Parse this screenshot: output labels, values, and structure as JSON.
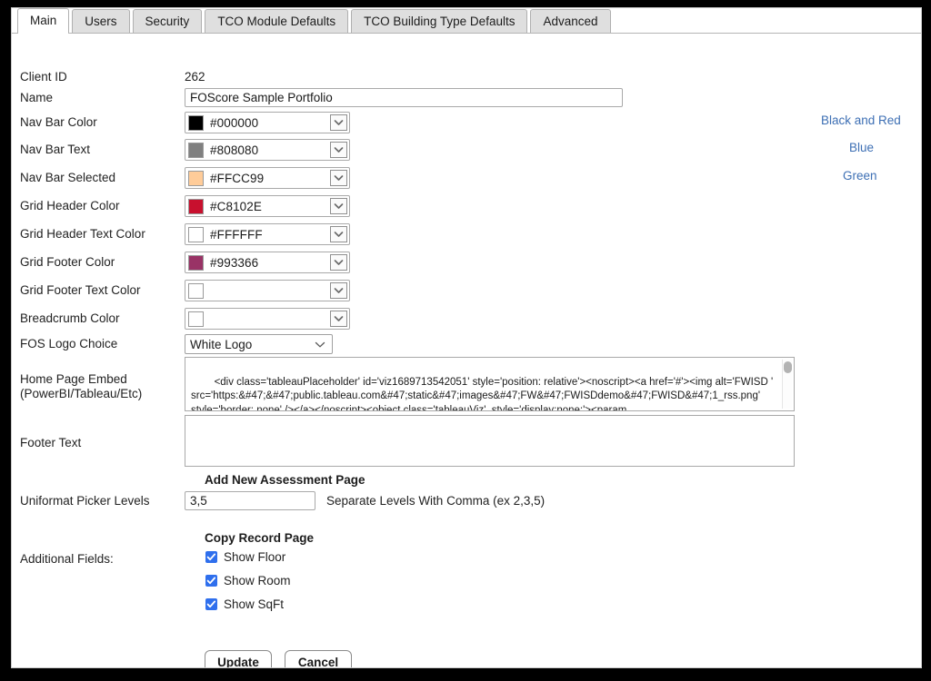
{
  "tabs": [
    {
      "label": "Main",
      "active": true
    },
    {
      "label": "Users",
      "active": false
    },
    {
      "label": "Security",
      "active": false
    },
    {
      "label": "TCO Module Defaults",
      "active": false
    },
    {
      "label": "TCO Building Type Defaults",
      "active": false
    },
    {
      "label": "Advanced",
      "active": false
    }
  ],
  "form": {
    "client_id_label": "Client ID",
    "client_id_value": "262",
    "name_label": "Name",
    "name_value": "FOScore Sample Portfolio",
    "nav_bar_color_label": "Nav Bar Color",
    "nav_bar_color_value": "#000000",
    "nav_bar_text_label": "Nav Bar Text",
    "nav_bar_text_value": "#808080",
    "nav_bar_selected_label": "Nav Bar Selected",
    "nav_bar_selected_value": "#FFCC99",
    "grid_header_color_label": "Grid Header Color",
    "grid_header_color_value": "#C8102E",
    "grid_header_text_color_label": "Grid Header Text Color",
    "grid_header_text_color_value": "#FFFFFF",
    "grid_footer_color_label": "Grid Footer Color",
    "grid_footer_color_value": "#993366",
    "grid_footer_text_color_label": "Grid Footer Text Color",
    "grid_footer_text_color_value": "",
    "breadcrumb_color_label": "Breadcrumb Color",
    "breadcrumb_color_value": "",
    "fos_logo_choice_label": "FOS Logo Choice",
    "fos_logo_choice_value": "White Logo",
    "home_page_embed_label": "Home Page Embed (PowerBI/Tableau/Etc)",
    "home_page_embed_value": "<div class='tableauPlaceholder' id='viz1689713542051' style='position: relative'><noscript><a href='#'><img alt='FWISD ' src='https:&#47;&#47;public.tableau.com&#47;static&#47;images&#47;FW&#47;FWISDdemo&#47;FWISD&#47;1_rss.png' style='border: none' /></a></noscript><object class='tableauViz'  style='display:none;'><param",
    "footer_text_label": "Footer Text",
    "footer_text_value": "",
    "add_new_assessment_page_heading": "Add New Assessment Page",
    "uniformat_picker_levels_label": "Uniformat Picker Levels",
    "uniformat_picker_levels_value": "3,5",
    "uniformat_helper": "Separate Levels With Comma (ex 2,3,5)",
    "additional_fields_label": "Additional Fields:",
    "copy_record_page_heading": "Copy Record Page",
    "checkboxes": [
      {
        "label": "Show Floor",
        "checked": true
      },
      {
        "label": "Show Room",
        "checked": true
      },
      {
        "label": "Show SqFt",
        "checked": true
      }
    ]
  },
  "presets": [
    {
      "label": "Black and Red"
    },
    {
      "label": "Blue"
    },
    {
      "label": "Green"
    }
  ],
  "actions": {
    "update_label": "Update",
    "cancel_label": "Cancel"
  },
  "colors": {
    "link": "#3d6fb4",
    "checkbox_accent": "#2f6fed",
    "frame": "#000000"
  }
}
